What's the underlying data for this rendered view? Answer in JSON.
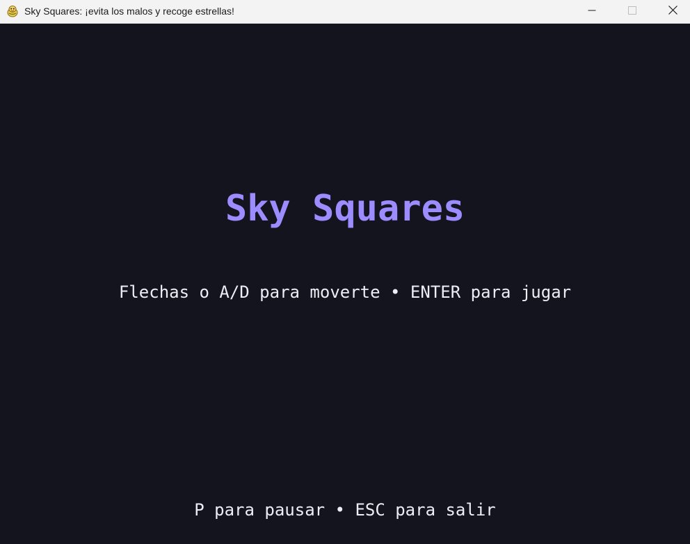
{
  "window": {
    "title": "Sky Squares: ¡evita los malos y recoge estrellas!",
    "icon": "pygame-snake-icon",
    "controls": [
      "minimize-icon",
      "maximize-icon",
      "close-icon"
    ]
  },
  "game": {
    "title": "Sky Squares",
    "instructions": "Flechas o A/D para moverte • ENTER para jugar",
    "controls_hint": "P para pausar • ESC para salir"
  },
  "colors": {
    "background": "#14141e",
    "title": "#9b8cff",
    "text": "#eceef5",
    "titlebar": "#f3f3f3"
  }
}
